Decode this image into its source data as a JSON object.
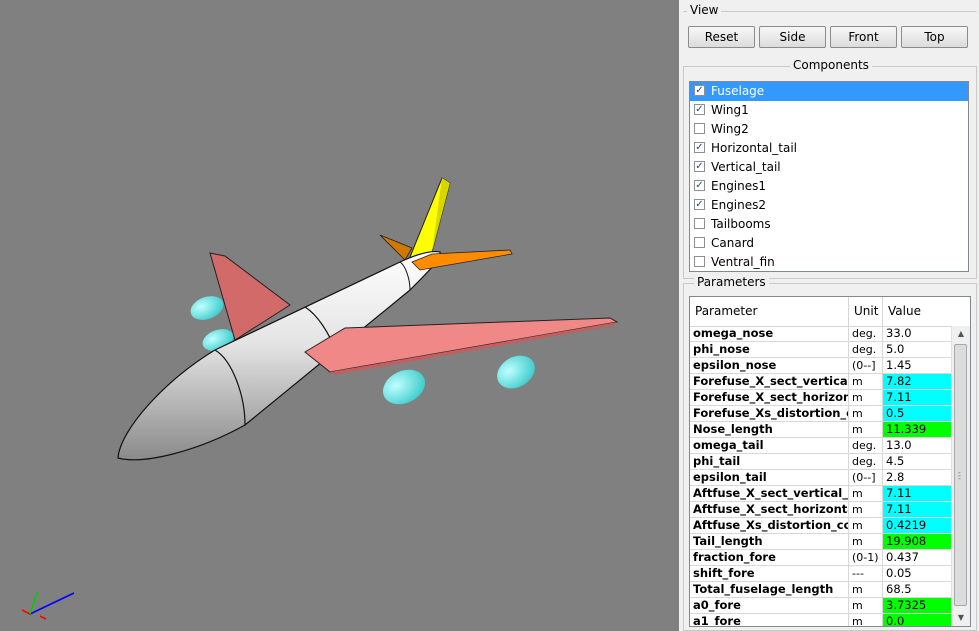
{
  "view": {
    "title": "View",
    "buttons": [
      "Reset",
      "Side",
      "Front",
      "Top"
    ]
  },
  "components": {
    "title": "Components",
    "items": [
      {
        "label": "Fuselage",
        "checked": true,
        "selected": true
      },
      {
        "label": "Wing1",
        "checked": true,
        "selected": false
      },
      {
        "label": "Wing2",
        "checked": false,
        "selected": false
      },
      {
        "label": "Horizontal_tail",
        "checked": true,
        "selected": false
      },
      {
        "label": "Vertical_tail",
        "checked": true,
        "selected": false
      },
      {
        "label": "Engines1",
        "checked": true,
        "selected": false
      },
      {
        "label": "Engines2",
        "checked": true,
        "selected": false
      },
      {
        "label": "Tailbooms",
        "checked": false,
        "selected": false
      },
      {
        "label": "Canard",
        "checked": false,
        "selected": false
      },
      {
        "label": "Ventral_fin",
        "checked": false,
        "selected": false
      }
    ]
  },
  "parameters": {
    "title": "Parameters",
    "headers": [
      "Parameter",
      "Unit",
      "Value"
    ],
    "rows": [
      {
        "name": "omega_nose",
        "unit": "deg.",
        "value": "33.0",
        "highlight": ""
      },
      {
        "name": "phi_nose",
        "unit": "deg.",
        "value": "5.0",
        "highlight": ""
      },
      {
        "name": "epsilon_nose",
        "unit": "(0--]",
        "value": "1.45",
        "highlight": ""
      },
      {
        "name": "Forefuse_X_sect_vertical...",
        "unit": "m",
        "value": "7.82",
        "highlight": "cyan"
      },
      {
        "name": "Forefuse_X_sect_horizon...",
        "unit": "m",
        "value": "7.11",
        "highlight": "cyan"
      },
      {
        "name": "Forefuse_Xs_distortion_c...",
        "unit": "m",
        "value": "0.5",
        "highlight": "cyan"
      },
      {
        "name": "Nose_length",
        "unit": "m",
        "value": "11.339",
        "highlight": "green"
      },
      {
        "name": "omega_tail",
        "unit": "deg.",
        "value": "13.0",
        "highlight": ""
      },
      {
        "name": "phi_tail",
        "unit": "deg.",
        "value": "4.5",
        "highlight": ""
      },
      {
        "name": "epsilon_tail",
        "unit": "(0--]",
        "value": "2.8",
        "highlight": ""
      },
      {
        "name": "Aftfuse_X_sect_vertical_...",
        "unit": "m",
        "value": "7.11",
        "highlight": "cyan"
      },
      {
        "name": "Aftfuse_X_sect_horizonta...",
        "unit": "m",
        "value": "7.11",
        "highlight": "cyan"
      },
      {
        "name": "Aftfuse_Xs_distortion_co...",
        "unit": "m",
        "value": "0.4219",
        "highlight": "cyan"
      },
      {
        "name": "Tail_length",
        "unit": "m",
        "value": "19.908",
        "highlight": "green"
      },
      {
        "name": "fraction_fore",
        "unit": "(0-1)",
        "value": "0.437",
        "highlight": ""
      },
      {
        "name": "shift_fore",
        "unit": "---",
        "value": "0.05",
        "highlight": ""
      },
      {
        "name": "Total_fuselage_length",
        "unit": "m",
        "value": "68.5",
        "highlight": ""
      },
      {
        "name": "a0_fore",
        "unit": "m",
        "value": "3.7325",
        "highlight": "green"
      },
      {
        "name": "a1_fore",
        "unit": "m",
        "value": "0.0",
        "highlight": "green"
      }
    ]
  },
  "viewport": {
    "background": "#808080",
    "colors": {
      "fuselage": "#e6e6e6",
      "wing": "#e88080",
      "engine": "#66e6e6",
      "vertical_tail": "#e6e600",
      "horizontal_tail": "#e68a00"
    }
  }
}
